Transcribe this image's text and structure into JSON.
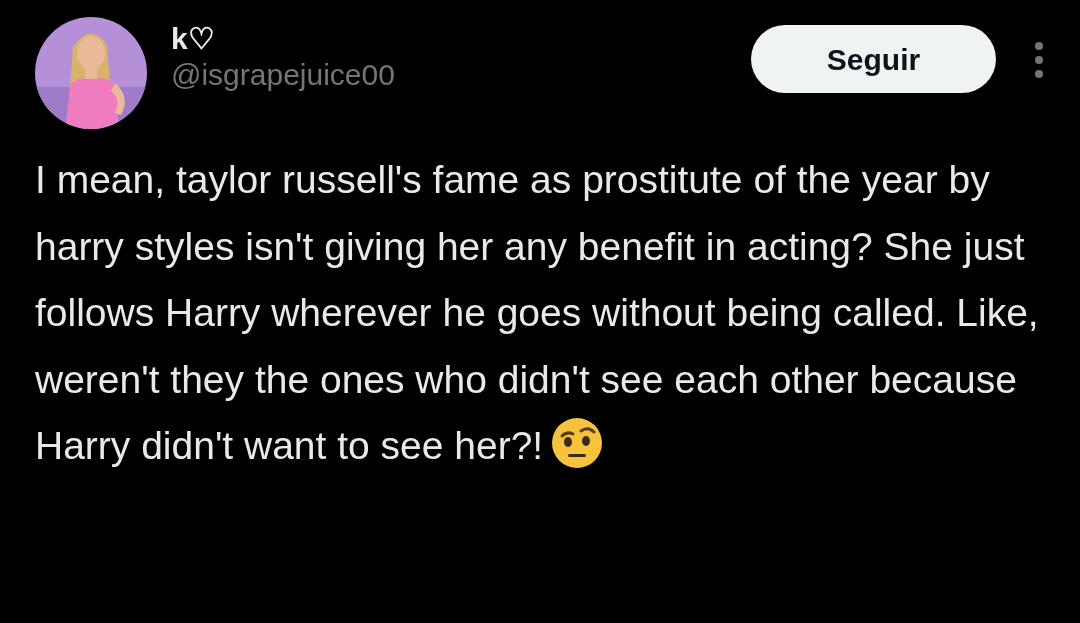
{
  "author": {
    "display_name": "k♡",
    "handle": "@isgrapejuice00"
  },
  "follow_button": {
    "label": "Seguir"
  },
  "tweet": {
    "text": "I mean, taylor russell's fame as prostitute of the year by harry styles isn't giving her any benefit in acting? She just follows Harry wherever he goes without being called. Like, weren't they the ones who didn't see each other because Harry didn't want to see her?!"
  }
}
